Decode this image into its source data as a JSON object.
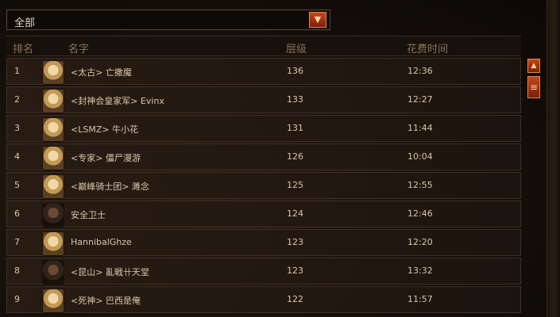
{
  "filter": {
    "selected": "全部",
    "dropdown_icon": "triangle-down-icon"
  },
  "columns": {
    "rank": "排名",
    "name": "名字",
    "level": "层级",
    "time": "花费时间"
  },
  "rows": [
    {
      "rank": "1",
      "name": "<太古> 亡撒魔",
      "level": "136",
      "time": "12:36",
      "avatar": "blonde"
    },
    {
      "rank": "2",
      "name": "<封神会皇家军> Evinx",
      "level": "133",
      "time": "12:27",
      "avatar": "blonde"
    },
    {
      "rank": "3",
      "name": "<LSMZ> 牛小花",
      "level": "131",
      "time": "11:44",
      "avatar": "blonde"
    },
    {
      "rank": "4",
      "name": "<专家> 僵尸漫游",
      "level": "126",
      "time": "10:04",
      "avatar": "blonde"
    },
    {
      "rank": "5",
      "name": "<巅峰骑士团> 濉念",
      "level": "125",
      "time": "12:55",
      "avatar": "blonde"
    },
    {
      "rank": "6",
      "name": "安全卫士",
      "level": "124",
      "time": "12:46",
      "avatar": "dark"
    },
    {
      "rank": "7",
      "name": "HannibalGhze",
      "level": "123",
      "time": "12:20",
      "avatar": "blonde"
    },
    {
      "rank": "8",
      "name": "<昆山> 亂戦卄天堂",
      "level": "123",
      "time": "13:32",
      "avatar": "dark"
    },
    {
      "rank": "9",
      "name": "<死神> 巴西是俺",
      "level": "122",
      "time": "11:57",
      "avatar": "blonde"
    }
  ],
  "scroll": {
    "up_icon": "triangle-up-icon",
    "thumb_icon": "scroll-thumb-icon"
  },
  "colors": {
    "accent": "#c4461c",
    "text": "#d8c6a6",
    "header_text": "#8a7358"
  }
}
